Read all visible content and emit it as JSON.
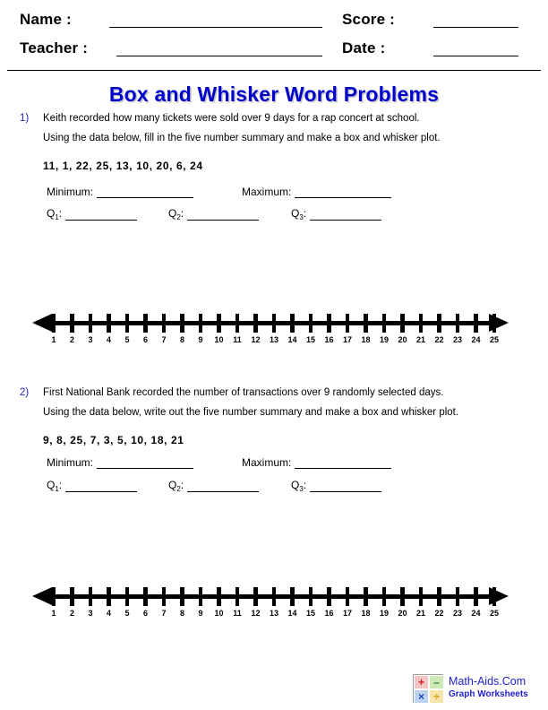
{
  "header": {
    "name_label": "Name :",
    "teacher_label": "Teacher :",
    "score_label": "Score :",
    "date_label": "Date :",
    "name_value": "",
    "teacher_value": "",
    "score_value": "",
    "date_value": ""
  },
  "title": "Box and Whisker Word Problems",
  "title_color": "#0000CC",
  "problems": [
    {
      "number": "1)",
      "line1": "Keith recorded how many tickets were sold over 9 days for a rap concert at school.",
      "line2": "Using the data below, fill in the five number summary and make a box and whisker plot.",
      "data": "11, 1, 22, 25, 13, 10, 20, 6, 24",
      "fields": {
        "minimum_label": "Minimum:",
        "maximum_label": "Maximum:",
        "q1_label": "Q",
        "q1_sub": "1",
        "q1_colon": ":",
        "q2_label": "Q",
        "q2_sub": "2",
        "q2_colon": ":",
        "q3_label": "Q",
        "q3_sub": "3",
        "q3_colon": ":",
        "minimum_value": "",
        "maximum_value": "",
        "q1_value": "",
        "q2_value": "",
        "q3_value": ""
      }
    },
    {
      "number": "2)",
      "line1": "First National Bank recorded the number of transactions over 9 randomly selected days.",
      "line2": "Using the data below, write out the five number summary and make a box and whisker plot.",
      "data": "9, 8, 25, 7, 3, 5, 10, 18, 21",
      "fields": {
        "minimum_label": "Minimum:",
        "maximum_label": "Maximum:",
        "q1_label": "Q",
        "q1_sub": "1",
        "q1_colon": ":",
        "q2_label": "Q",
        "q2_sub": "2",
        "q2_colon": ":",
        "q3_label": "Q",
        "q3_sub": "3",
        "q3_colon": ":",
        "minimum_value": "",
        "maximum_value": "",
        "q1_value": "",
        "q2_value": "",
        "q3_value": ""
      }
    }
  ],
  "number_line": {
    "ticks": [
      1,
      2,
      3,
      4,
      5,
      6,
      7,
      8,
      9,
      10,
      11,
      12,
      13,
      14,
      15,
      16,
      17,
      18,
      19,
      20,
      21,
      22,
      23,
      24,
      25
    ],
    "min": 1,
    "max": 25,
    "left_arrow": "arrow-left",
    "right_arrow": "arrow-right"
  },
  "footer": {
    "brand": "Math-Aids.Com",
    "subtitle": "Graph Worksheets",
    "brand_color": "#2222CC",
    "logo_cells": [
      {
        "glyph": "+",
        "name": "plus-icon"
      },
      {
        "glyph": "–",
        "name": "minus-icon"
      },
      {
        "glyph": "×",
        "name": "multiply-icon"
      },
      {
        "glyph": "÷",
        "name": "divide-icon"
      }
    ]
  }
}
